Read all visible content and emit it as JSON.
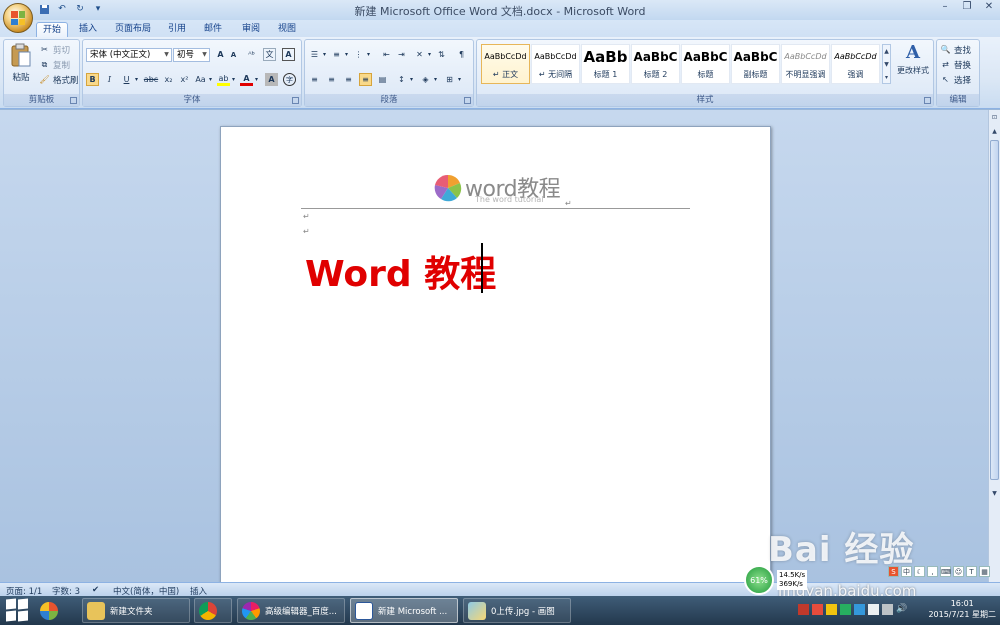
{
  "window": {
    "title": "新建 Microsoft Office Word 文档.docx - Microsoft Word",
    "controls": [
      "minimize-icon",
      "restore-icon",
      "close-icon"
    ]
  },
  "qat": {
    "icons": [
      "save-icon",
      "undo-icon",
      "redo-icon",
      "customize-icon"
    ]
  },
  "tabs": [
    "开始",
    "插入",
    "页面布局",
    "引用",
    "邮件",
    "审阅",
    "视图"
  ],
  "active_tab": "开始",
  "ribbon": {
    "clipboard": {
      "label": "剪贴板",
      "paste": "粘贴",
      "cut": "剪切",
      "copy": "复制",
      "format_painter": "格式刷"
    },
    "font": {
      "label": "字体",
      "font_name": "宋体 (中文正文)",
      "font_size": "初号",
      "grow": "A",
      "shrink": "A",
      "bold": "B",
      "italic": "I",
      "underline": "U",
      "strike": "abc",
      "subscript": "x₂",
      "superscript": "x²",
      "case": "Aa",
      "highlight": "ab",
      "font_color": "A",
      "char_shade": "A",
      "enclose": "字"
    },
    "paragraph": {
      "label": "段落"
    },
    "styles": {
      "label": "样式",
      "tiles": [
        {
          "sample": "AaBbCcDd",
          "name": "↵ 正文"
        },
        {
          "sample": "AaBbCcDd",
          "name": "↵ 无间隔"
        },
        {
          "sample": "AaBb",
          "name": "标题 1"
        },
        {
          "sample": "AaBbC",
          "name": "标题 2"
        },
        {
          "sample": "AaBbC",
          "name": "标题"
        },
        {
          "sample": "AaBbC",
          "name": "副标题"
        },
        {
          "sample": "AaBbCcDd",
          "name": "不明显强调"
        },
        {
          "sample": "AaBbCcDd",
          "name": "强调"
        }
      ],
      "change_styles": "更改样式"
    },
    "editing": {
      "label": "编辑",
      "find": "查找",
      "replace": "替换",
      "select": "选择"
    }
  },
  "document": {
    "header_wordmark": "word教程",
    "header_sub": "The word tutorial",
    "title_text": "Word 教程",
    "paragraph_mark": "↵",
    "title_color": "#e00000"
  },
  "statusbar": {
    "page": "页面: 1/1",
    "words": "字数: 3",
    "language": "中文(简体，中国)",
    "mode": "插入"
  },
  "net_widget": {
    "percent": "61%",
    "up": "14.5K/s",
    "down": "369K/s"
  },
  "watermark": {
    "brand": "Bai 经验",
    "url": "jingyan.baidu.com"
  },
  "taskbar": {
    "items": [
      {
        "label": "新建文件夹"
      },
      {
        "label": ""
      },
      {
        "label": "高级编辑器_百度..."
      },
      {
        "label": "新建 Microsoft ..."
      },
      {
        "label": "0上传.jpg - 画图"
      }
    ],
    "clock_time": "16:01",
    "clock_date": "2015/7/21 星期二"
  }
}
